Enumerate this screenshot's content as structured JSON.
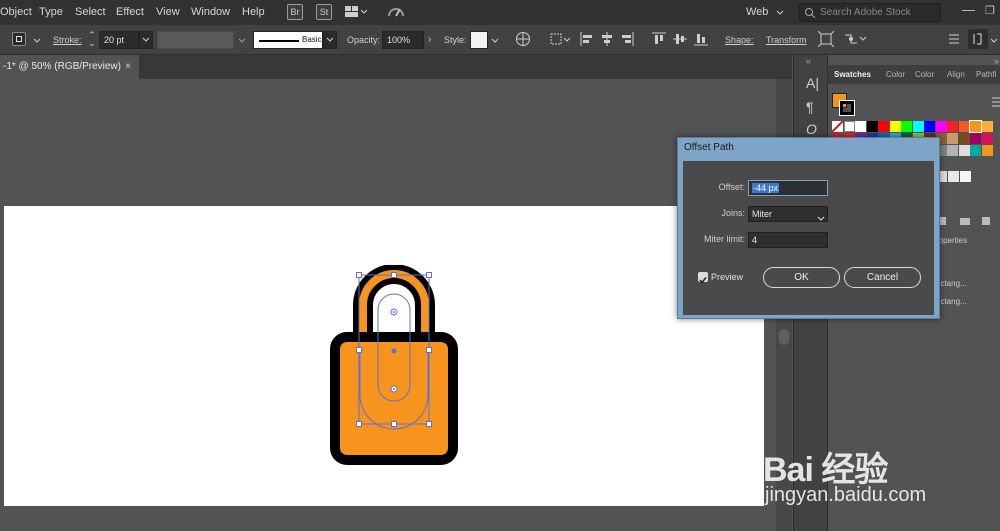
{
  "menubar": {
    "items": [
      "Object",
      "Type",
      "Select",
      "Effect",
      "View",
      "Window",
      "Help"
    ],
    "app_icons": [
      "Br",
      "St"
    ],
    "workspace": "Web",
    "search_placeholder": "Search Adobe Stock"
  },
  "control_bar": {
    "stroke_label": "Stroke:",
    "stroke_value": "20 pt",
    "brush_label": "Basic",
    "opacity_label": "Opacity:",
    "opacity_value": "100%",
    "style_label": "Style:",
    "shape_label": "Shape:",
    "transform_label": "Transform"
  },
  "document_tab": {
    "title": "-1* @ 50% (RGB/Preview)",
    "close": "×"
  },
  "panel": {
    "tabs": [
      "Swatches",
      "Color",
      "Color",
      "Align",
      "Pathfi"
    ],
    "active_tab": "Swatches",
    "properties_label": "roperties",
    "layer_rows": [
      "ectang...",
      "ectang..."
    ],
    "fill_color": "#f7941d"
  },
  "dialog": {
    "title": "Offset Path",
    "offset_label": "Offset:",
    "offset_value": "-44 px",
    "joins_label": "Joins:",
    "joins_value": "Miter",
    "miter_label": "Miter limit:",
    "miter_value": "4",
    "preview_label": "Preview",
    "preview_checked": true,
    "ok_label": "OK",
    "cancel_label": "Cancel"
  },
  "artwork": {
    "fill": "#f7941d",
    "stroke": "#000000",
    "selection_color": "#5b6fd6"
  },
  "watermark": {
    "line1": "Bai 经验",
    "line2": "jingyan.baidu.com"
  }
}
